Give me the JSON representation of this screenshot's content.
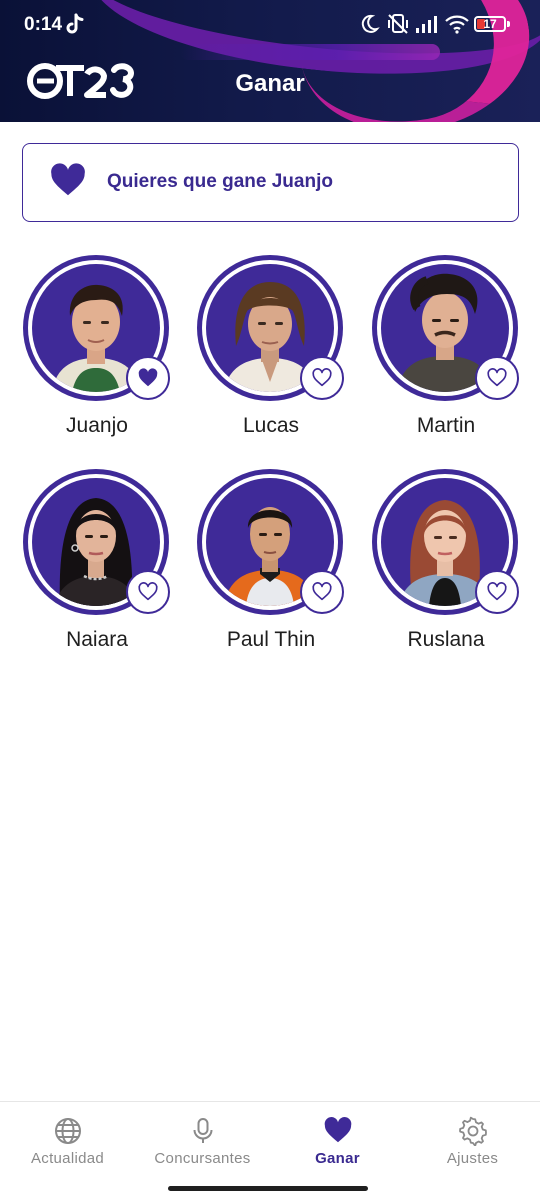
{
  "status_bar": {
    "time": "0:14",
    "battery": "17",
    "icons": [
      "tiktok-icon",
      "moon-icon",
      "vibrate-off-icon",
      "signal-icon",
      "wifi-icon",
      "battery-icon"
    ]
  },
  "app_bar": {
    "logo_text": "OT23",
    "title": "Ganar"
  },
  "banner": {
    "text": "Quieres que gane Juanjo",
    "icon": "heart-icon"
  },
  "contestants": [
    {
      "name": "Juanjo",
      "favorite": true
    },
    {
      "name": "Lucas",
      "favorite": false
    },
    {
      "name": "Martin",
      "favorite": false
    },
    {
      "name": "Naiara",
      "favorite": false
    },
    {
      "name": "Paul Thin",
      "favorite": false
    },
    {
      "name": "Ruslana",
      "favorite": false
    }
  ],
  "bottom_nav": {
    "items": [
      {
        "label": "Actualidad",
        "icon": "globe-icon"
      },
      {
        "label": "Concursantes",
        "icon": "microphone-icon"
      },
      {
        "label": "Ganar",
        "icon": "heart-icon",
        "active": true
      },
      {
        "label": "Ajustes",
        "icon": "gear-icon"
      }
    ]
  },
  "colors": {
    "accent": "#3f2a98",
    "header_bg": "#0f1545",
    "header_pink": "#e0249a",
    "nav_inactive": "#8a8a8a"
  }
}
